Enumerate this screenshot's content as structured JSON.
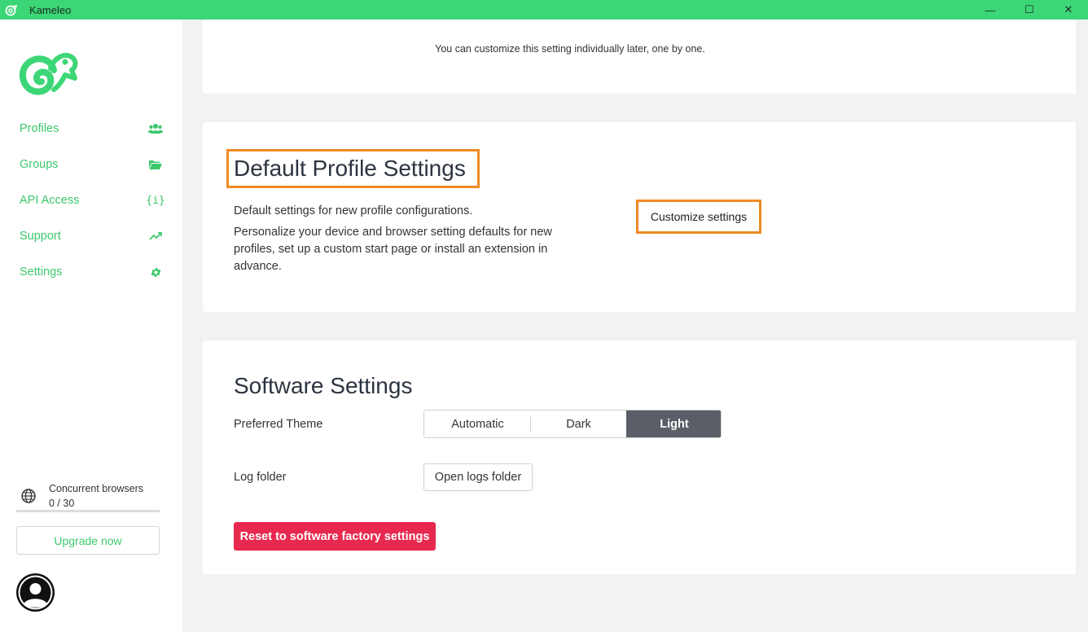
{
  "window": {
    "title": "Kameleo",
    "controls": [
      "—",
      "☐",
      "✕"
    ]
  },
  "colors": {
    "brand_green": "#3cd676",
    "accent_orange": "#f08a24",
    "danger_red": "#e8294f",
    "active_theme": "#5a5e66"
  },
  "sidebar": {
    "items": [
      {
        "label": "Profiles",
        "icon": "users-icon"
      },
      {
        "label": "Groups",
        "icon": "folder-open-icon"
      },
      {
        "label": "API Access",
        "icon": "braces-icon"
      },
      {
        "label": "Support",
        "icon": "trend-icon"
      },
      {
        "label": "Settings",
        "icon": "gear-icon"
      }
    ],
    "concurrent": {
      "label": "Concurrent browsers",
      "value": "0 / 30"
    },
    "upgrade_label": "Upgrade now"
  },
  "top_card": {
    "note": "You can customize this setting individually later, one by one."
  },
  "default_profile": {
    "title": "Default Profile Settings",
    "desc1": "Default settings for new profile configurations.",
    "desc2": "Personalize your device and browser setting defaults for new profiles, set up a custom start page or install an extension in advance.",
    "button": "Customize settings"
  },
  "software": {
    "title": "Software Settings",
    "theme_label": "Preferred Theme",
    "theme_options": [
      "Automatic",
      "Dark",
      "Light"
    ],
    "theme_selected": "Light",
    "log_label": "Log folder",
    "log_button": "Open logs folder",
    "reset_button": "Reset to software factory settings"
  }
}
